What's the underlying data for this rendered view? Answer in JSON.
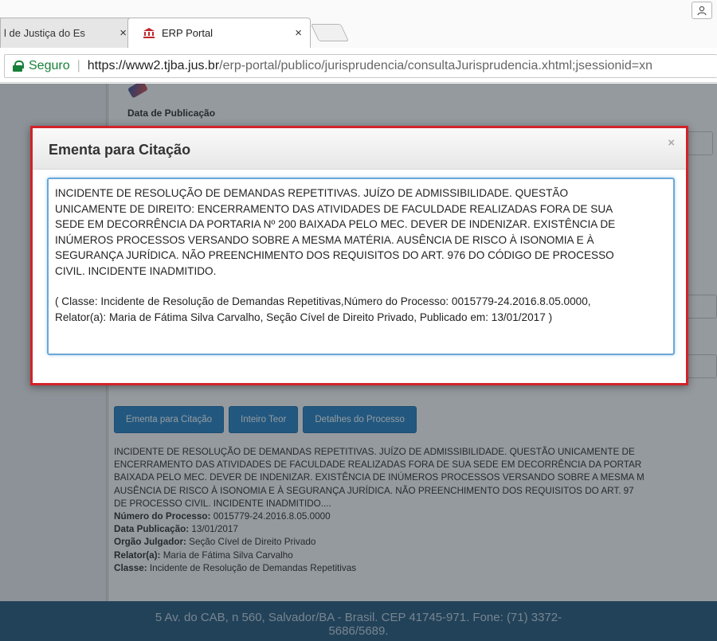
{
  "browser": {
    "tabs": [
      {
        "label": "l de Justiça do Es"
      },
      {
        "label": "ERP Portal"
      }
    ],
    "tab_close_glyph": "×",
    "address": {
      "secure_label": "Seguro",
      "url_host": "https://www2.tjba.jus.br",
      "url_path": "/erp-portal/publico/jurisprudencia/consultaJurisprudencia.xhtml;jsessionid=xn"
    },
    "profile_icon": "person-icon"
  },
  "page": {
    "date_label": "Data de Publicação",
    "buttons": [
      {
        "label": "Ementa para Citação"
      },
      {
        "label": "Inteiro Teor"
      },
      {
        "label": "Detalhes do Processo"
      }
    ],
    "result": {
      "summary_lines": [
        "INCIDENTE DE RESOLUÇÃO DE DEMANDAS REPETITIVAS. JUÍZO DE ADMISSIBILIDADE. QUESTÃO UNICAMENTE DE",
        "ENCERRAMENTO DAS ATIVIDADES DE FACULDADE REALIZADAS FORA DE SUA SEDE EM DECORRÊNCIA DA PORTAR",
        "BAIXADA PELO MEC. DEVER DE INDENIZAR. EXISTÊNCIA DE INÚMEROS PROCESSOS VERSANDO SOBRE A MESMA M",
        "AUSÊNCIA DE RISCO À ISONOMIA E À SEGURANÇA JURÍDICA. NÃO PREENCHIMENTO DOS REQUISITOS DO ART. 97",
        "DE PROCESSO CIVIL. INCIDENTE INADMITIDO...."
      ],
      "fields": [
        {
          "label": "Número do Processo:",
          "value": " 0015779-24.2016.8.05.0000"
        },
        {
          "label": "Data Publicação:",
          "value": " 13/01/2017"
        },
        {
          "label": "Orgão Julgador:",
          "value": " Seção Cível de Direito Privado"
        },
        {
          "label": "Relator(a):",
          "value": " Maria de Fátima Silva Carvalho"
        },
        {
          "label": "Classe:",
          "value": " Incidente de Resolução de Demandas Repetitivas"
        }
      ]
    },
    "footer": {
      "line1": "5 Av. do CAB, n 560, Salvador/BA - Brasil. CEP 41745-971. Fone: (71) 3372-",
      "line2": "5686/5689."
    }
  },
  "modal": {
    "title": "Ementa para Citação",
    "close_glyph": "×",
    "lines": [
      "INCIDENTE DE RESOLUÇÃO DE DEMANDAS REPETITIVAS. JUÍZO DE ADMISSIBILIDADE. QUESTÃO",
      "UNICAMENTE DE DIREITO: ENCERRAMENTO DAS ATIVIDADES DE FACULDADE REALIZADAS FORA DE SUA",
      "SEDE EM DECORRÊNCIA DA PORTARIA Nº 200 BAIXADA PELO MEC. DEVER DE INDENIZAR. EXISTÊNCIA DE",
      "INÚMEROS PROCESSOS VERSANDO SOBRE A MESMA MATÉRIA. AUSÊNCIA DE RISCO À ISONOMIA E À",
      "SEGURANÇA JURÍDICA. NÃO PREENCHIMENTO DOS REQUISITOS DO ART. 976 DO CÓDIGO DE PROCESSO",
      "CIVIL. INCIDENTE INADMITIDO."
    ],
    "citation_lines": [
      " ( Classe: Incidente de Resolução de Demandas Repetitivas,Número do Processo: 0015779-24.2016.8.05.0000,",
      "Relator(a): Maria de Fátima Silva Carvalho, Seção Cível de Direito Privado, Publicado em: 13/01/2017 )"
    ]
  },
  "colors": {
    "accent_button": "#2f88c8",
    "highlight_border": "#d1232a",
    "secure_green": "#188038",
    "footer_bg": "#2e5f82"
  }
}
